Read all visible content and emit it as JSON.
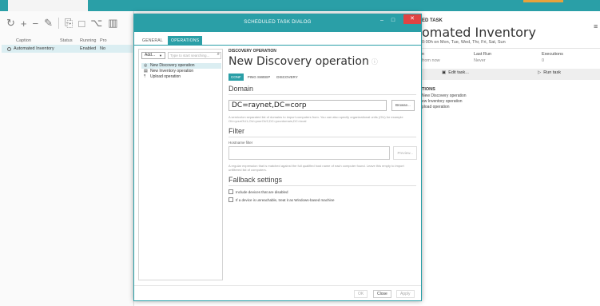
{
  "colors": {
    "accent": "#2a9fa7",
    "close": "#e04343",
    "selection": "#dbeef2"
  },
  "bg_left": {
    "toolbar_icons": [
      "refresh-icon",
      "add-icon",
      "remove-icon",
      "edit-icon",
      "copy-icon",
      "delete-icon",
      "share-icon",
      "grid-icon"
    ],
    "columns": [
      "Caption",
      "Status",
      "Running",
      "Pro"
    ],
    "row": {
      "caption": "Automated Inventory",
      "status": "Enabled",
      "running": "No"
    }
  },
  "bg_right": {
    "label": "ED TASK",
    "title": "omated Inventory",
    "subtitle": "0:00h on Mon, Tue, Wed, Thr, Fri, Sat, Sun",
    "col1": {
      "label": "n",
      "value": "from now"
    },
    "col2": {
      "label": "Last Run",
      "value": "Never"
    },
    "col3": {
      "label": "Executions",
      "value": "0"
    },
    "edit_task": "Edit task...",
    "run_task": "Run task",
    "ops_heading": "TIONS",
    "ops": [
      "New Discovery operation",
      "ew Inventory operation",
      "pload operation"
    ]
  },
  "dialog": {
    "title": "SCHEDULED TASK DIALOG",
    "tabs": [
      "GENERAL",
      "OPERATIONS"
    ],
    "add_label": "Add...",
    "search_placeholder": "Type to start searching...",
    "operations": [
      {
        "label": "New Discovery operation",
        "icon": "discovery-icon"
      },
      {
        "label": "New Inventory operation",
        "icon": "inventory-icon"
      },
      {
        "label": "Upload operation",
        "icon": "upload-icon"
      }
    ],
    "content": {
      "section_label": "DISCOVERY OPERATION",
      "title": "New Discovery operation",
      "sub_tabs": [
        "CONF",
        "PING SWEEP",
        "DISCOVERY"
      ],
      "domain_heading": "Domain",
      "domain_value": "DC=raynet,DC=corp",
      "browse": "Browse...",
      "domain_help": "A semicolon separated list of domains to import computers from. You can also specify organizational units (OU) for example OU=yourOU1,OU=yourOU2,DC=yourdomain,DC=local",
      "filter_heading": "Filter",
      "hostname_label": "Hostname filter",
      "preview": "Preview...",
      "filter_help": "A regular expression that is matched against the full qualified host name of each computer found. Leave this empty to import unfiltered list of computers.",
      "fallback_heading": "Fallback settings",
      "opt1": "Include devices that are disabled",
      "opt2": "If a device is unreachable, treat it as Windows-based machine"
    },
    "footer": {
      "ok": "OK",
      "close": "Close",
      "apply": "Apply"
    }
  }
}
